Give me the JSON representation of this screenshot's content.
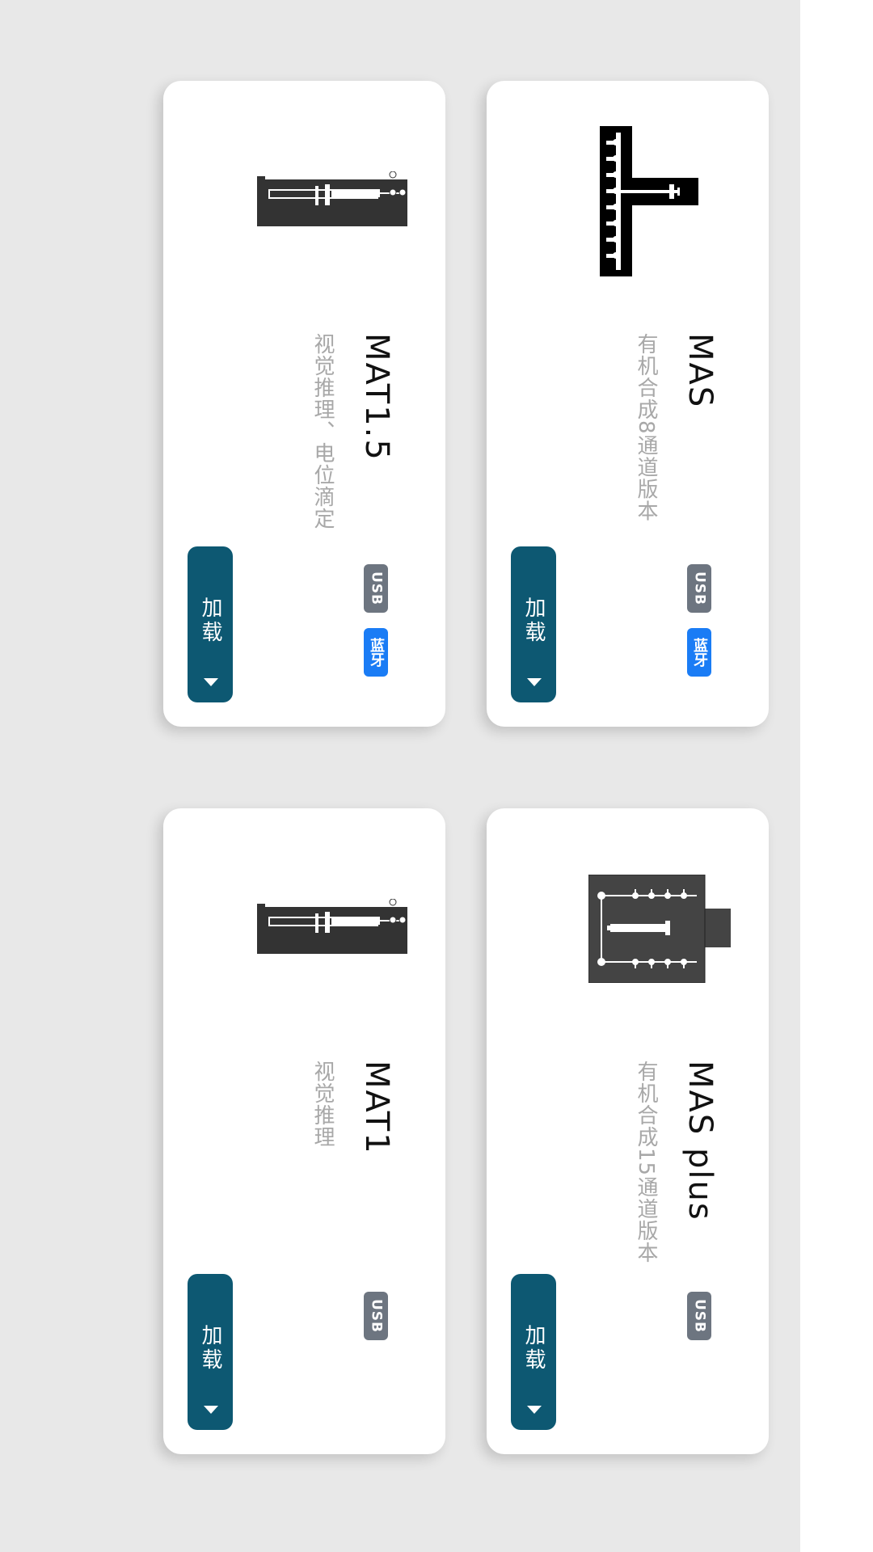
{
  "devices": [
    {
      "name": "MAS",
      "desc": "有机合成8通道版本",
      "badges": [
        "USB",
        "蓝牙"
      ],
      "button": "加载",
      "icon": "mas-device-icon"
    },
    {
      "name": "MAT1.5",
      "desc": "视觉推理、电位滴定",
      "badges": [
        "USB",
        "蓝牙"
      ],
      "button": "加载",
      "icon": "syringe-pump-icon"
    },
    {
      "name": "MAS plus",
      "desc": "有机合成15通道版本",
      "badges": [
        "USB"
      ],
      "button": "加载",
      "icon": "mas-plus-device-icon"
    },
    {
      "name": "MAT1",
      "desc": "视觉推理",
      "badges": [
        "USB"
      ],
      "button": "加载",
      "icon": "syringe-pump-icon"
    }
  ],
  "colors": {
    "button": "#0d5872",
    "usb_badge": "#6d7580",
    "bt_badge": "#1a7cf5",
    "background": "#e8e8e8"
  },
  "menu": {
    "icon": "menu-icon"
  }
}
